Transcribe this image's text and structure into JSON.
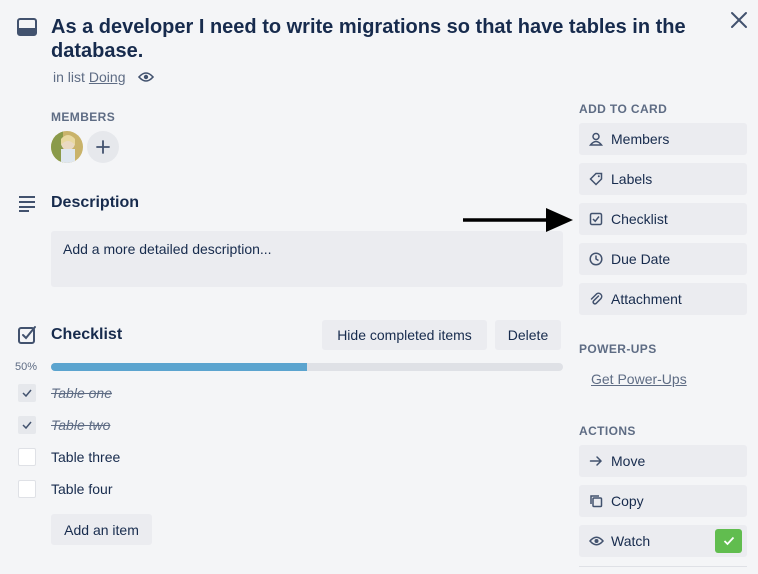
{
  "card": {
    "title": "As a developer I need to write migrations so that have tables in the database.",
    "in_list_prefix": "in list",
    "list_name": "Doing"
  },
  "members": {
    "label": "MEMBERS"
  },
  "description": {
    "heading": "Description",
    "placeholder": "Add a more detailed description..."
  },
  "checklist": {
    "heading": "Checklist",
    "hide_label": "Hide completed items",
    "delete_label": "Delete",
    "progress_text": "50%",
    "progress_fraction": 0.5,
    "items": [
      {
        "text": "Table one",
        "done": true
      },
      {
        "text": "Table two",
        "done": true
      },
      {
        "text": "Table three",
        "done": false
      },
      {
        "text": "Table four",
        "done": false
      }
    ],
    "add_item_label": "Add an item"
  },
  "sidebar": {
    "add_to_card_label": "ADD TO CARD",
    "add_to_card": [
      {
        "label": "Members",
        "icon": "person-icon"
      },
      {
        "label": "Labels",
        "icon": "tag-icon"
      },
      {
        "label": "Checklist",
        "icon": "checkbox-icon"
      },
      {
        "label": "Due Date",
        "icon": "clock-icon"
      },
      {
        "label": "Attachment",
        "icon": "paperclip-icon"
      }
    ],
    "powerups_label": "POWER-UPS",
    "get_powerups": "Get Power-Ups",
    "actions_label": "ACTIONS",
    "actions": [
      {
        "label": "Move",
        "icon": "arrow-right-icon"
      },
      {
        "label": "Copy",
        "icon": "copy-icon"
      },
      {
        "label": "Watch",
        "icon": "eye-icon"
      }
    ]
  },
  "colors": {
    "progress": "#5ba4cf",
    "watch_check": "#61bd4f"
  }
}
